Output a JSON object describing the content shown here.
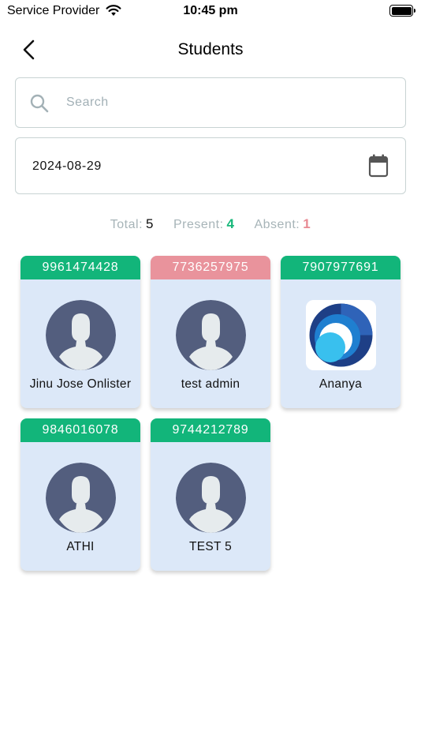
{
  "status_bar": {
    "carrier": "Service Provider",
    "time": "10:45 pm"
  },
  "nav": {
    "title": "Students",
    "back_icon": "chevron-left-icon"
  },
  "search": {
    "placeholder": "Search",
    "value": "",
    "icon": "search-icon"
  },
  "date_field": {
    "value": "2024-08-29",
    "icon": "calendar-icon"
  },
  "summary": {
    "total_label": "Total:",
    "total": "5",
    "present_label": "Present:",
    "present": "4",
    "absent_label": "Absent:",
    "absent": "1"
  },
  "colors": {
    "present": "#12b57a",
    "absent": "#e9939c",
    "card_bg": "#dce8f8",
    "avatar_bg": "#535e7e"
  },
  "students": [
    {
      "phone": "9961474428",
      "name": "Jinu Jose Onlister",
      "status": "present",
      "avatar": "default-avatar"
    },
    {
      "phone": "7736257975",
      "name": "test admin",
      "status": "absent",
      "avatar": "default-avatar"
    },
    {
      "phone": "7907977691",
      "name": "Ananya",
      "status": "present",
      "avatar": "logo-avatar"
    },
    {
      "phone": "9846016078",
      "name": "ATHI",
      "status": "present",
      "avatar": "default-avatar"
    },
    {
      "phone": "9744212789",
      "name": "TEST 5",
      "status": "present",
      "avatar": "default-avatar"
    }
  ]
}
